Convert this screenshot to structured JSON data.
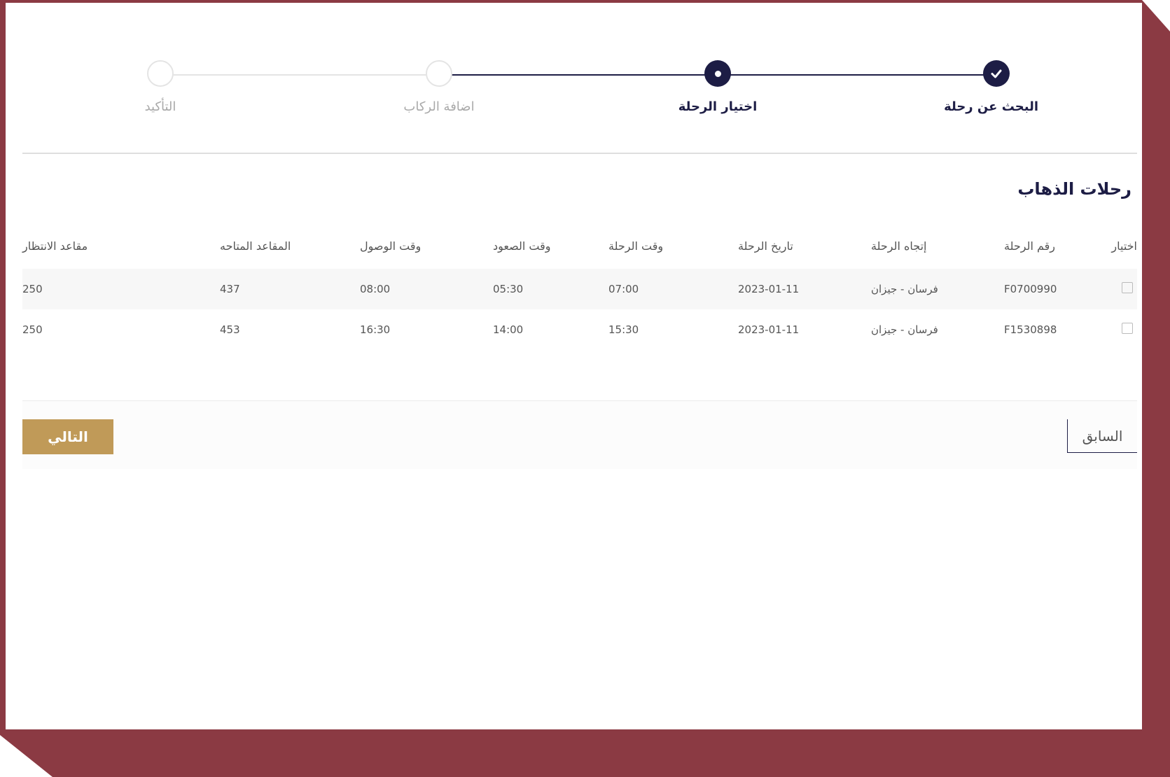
{
  "stepper": {
    "steps": [
      {
        "label": "البحث عن رحلة",
        "state": "done",
        "icon": "check-icon"
      },
      {
        "label": "اختيار الرحلة",
        "state": "active",
        "icon": "dot-icon"
      },
      {
        "label": "اضافة الركاب",
        "state": "todo",
        "icon": ""
      },
      {
        "label": "التأكيد",
        "state": "todo",
        "icon": ""
      }
    ]
  },
  "section": {
    "title": "رحلات الذهاب"
  },
  "table": {
    "headers": {
      "select": "اختيار",
      "flight_number": "رقم الرحلة",
      "direction": "إتجاه الرحلة",
      "date": "تاريخ الرحلة",
      "time": "وقت الرحلة",
      "boarding": "وقت الصعود",
      "arrival": "وقت الوصول",
      "available": "المقاعد المتاحه",
      "waiting": "مقاعد الانتظار"
    },
    "rows": [
      {
        "flight_number": "F0700990",
        "direction": "فرسان - جيزان",
        "date": "2023-01-11",
        "time": "07:00",
        "boarding": "05:30",
        "arrival": "08:00",
        "available": "437",
        "waiting": "250"
      },
      {
        "flight_number": "F1530898",
        "direction": "فرسان - جيزان",
        "date": "2023-01-11",
        "time": "15:30",
        "boarding": "14:00",
        "arrival": "16:30",
        "available": "453",
        "waiting": "250"
      }
    ]
  },
  "footer": {
    "next_label": "التالي",
    "prev_label": "السابق"
  },
  "colors": {
    "primary": "#1d1d45",
    "accent": "#c09a58",
    "frame": "#8b3a43"
  }
}
